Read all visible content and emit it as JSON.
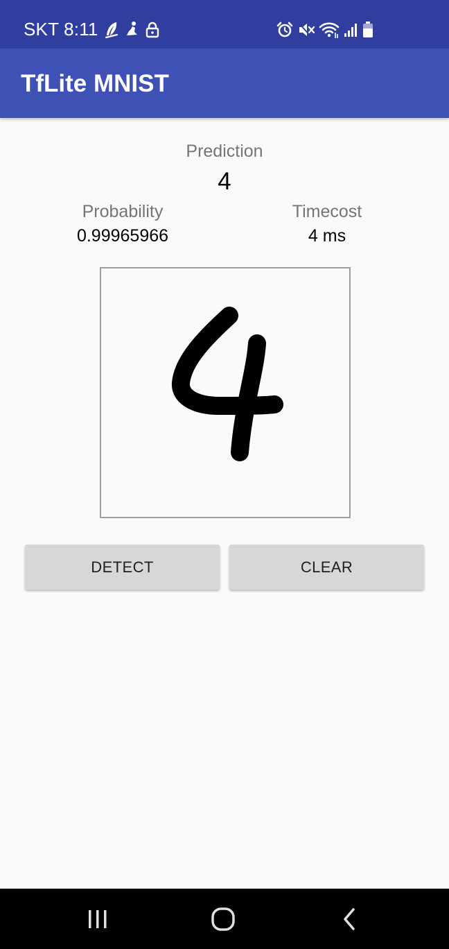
{
  "status_bar": {
    "carrier_time": "SKT 8:11",
    "left_icons": [
      "feather-icon",
      "person-walk-icon",
      "lock-icon"
    ],
    "right_icons": [
      "alarm-icon",
      "mute-icon",
      "wifi-icon",
      "signal-icon",
      "battery-icon"
    ]
  },
  "app_bar": {
    "title": "TfLite MNIST"
  },
  "prediction": {
    "label": "Prediction",
    "value": "4"
  },
  "probability": {
    "label": "Probability",
    "value": "0.99965966"
  },
  "timecost": {
    "label": "Timecost",
    "value": "4 ms"
  },
  "drawing_canvas": {
    "content": "handwritten digit 4",
    "stroke_color": "#000000"
  },
  "buttons": {
    "detect_label": "DETECT",
    "clear_label": "CLEAR"
  },
  "nav_bar": {
    "items": [
      "recents-icon",
      "home-icon",
      "back-icon"
    ]
  },
  "colors": {
    "status_bar": "#303f9f",
    "app_bar": "#3f51b5",
    "background": "#fafafa",
    "button": "#d6d7d7",
    "nav_bar": "#000000"
  }
}
